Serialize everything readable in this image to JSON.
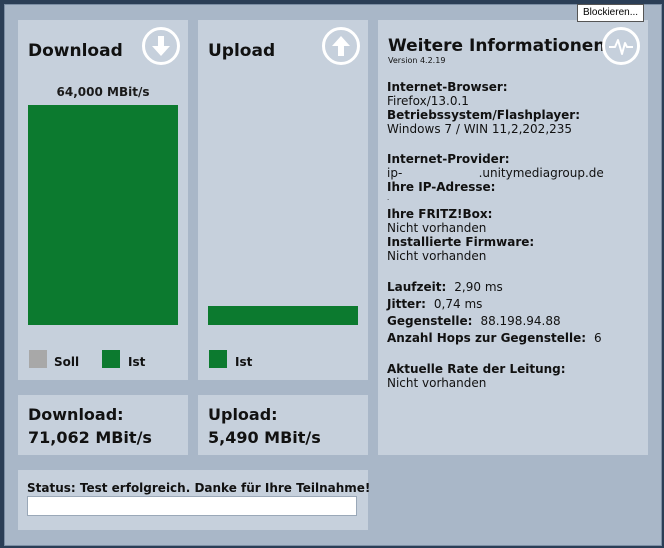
{
  "blocker": {
    "label": "Blockieren..."
  },
  "download_panel": {
    "title": "Download",
    "rate_label": "64,000 MBit/s",
    "bar_fill": 1.0,
    "legend": {
      "soll": "Soll",
      "ist": "Ist"
    }
  },
  "upload_panel": {
    "title": "Upload",
    "bar_fill": 0.0858,
    "legend": {
      "ist": "Ist"
    }
  },
  "download_result": {
    "label": "Download:",
    "value": "71,062 MBit/s"
  },
  "upload_result": {
    "label": "Upload:",
    "value": "5,490 MBit/s"
  },
  "status": {
    "text": "Status: Test erfolgreich. Danke für Ihre Teilnahme!",
    "field_value": ""
  },
  "info": {
    "title": "Weitere Informationen",
    "version": "Version 4.2.19",
    "browser_label": "Internet-Browser:",
    "browser_value": "Firefox/13.0.1",
    "os_label": "Betriebssystem/Flashplayer:",
    "os_value": "Windows 7 / WIN 11,2,202,235",
    "provider_label": "Internet-Provider:",
    "provider_value": "ip-                    .unitymediagroup.de",
    "ip_label": "Ihre IP-Adresse:",
    "ip_value": ".",
    "fritz_label": "Ihre FRITZ!Box:",
    "fritz_value": "Nicht vorhanden",
    "firmware_label": "Installierte Firmware:",
    "firmware_value": "Nicht vorhanden",
    "laufzeit_label": "Laufzeit:",
    "laufzeit_value": "2,90 ms",
    "jitter_label": "Jitter:",
    "jitter_value": "0,74 ms",
    "gegenstelle_label": "Gegenstelle:",
    "gegenstelle_value": "88.198.94.88",
    "hops_label": "Anzahl Hops zur Gegenstelle:",
    "hops_value": "6",
    "rate_label": "Aktuelle Rate der Leitung:",
    "rate_value": "Nicht vorhanden"
  },
  "colors": {
    "ist": "#0c7a2f",
    "soll": "#a8a8a8",
    "panel": "#c6d0dc",
    "frame": "#a9b7c8"
  },
  "icons": {
    "download": "download-arrow-icon",
    "upload": "upload-arrow-icon",
    "info": "pulse-icon"
  }
}
